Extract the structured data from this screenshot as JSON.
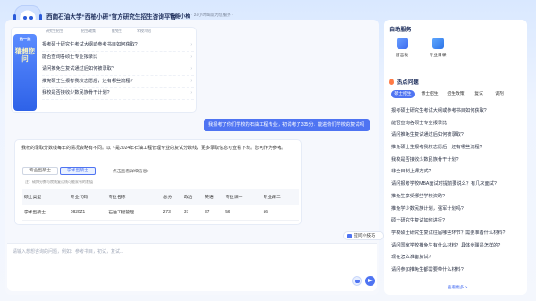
{
  "header": {
    "title": "西南石油大学“西柚小研”官方研究生招生咨询平台",
    "tag": "智能小柚",
    "subtitle": "· 24小时竭诚为您服务 ·"
  },
  "welcome": {
    "tabs": [
      "研究生招生",
      "招生政策",
      "推免生",
      "学校介绍"
    ],
    "banner_label": "热一热",
    "banner_vertical": "猜想您问",
    "questions": [
      "报考硕士研究生考试大纲或参考书目如何获取?",
      "能否查询各硕士专业报录比",
      "请问推免生复试通过后如何被录取?",
      "推免硕士生报考我校志愿后，还有哪些流程?",
      "我校是否接收少数民族骨干计划?"
    ]
  },
  "user_message": "我报考了你们学校的石油工程专业，初试考了335分，能进你们学校的复试吗",
  "answer": {
    "paragraph": "我校的录取分数线每年的情况会略有不同。以下是2024年石油工程管理专业的复试分数线，更多录取信息可查看下表。您可作为参考。",
    "seg_options": [
      "专业型硕士",
      "学术型硕士"
    ],
    "seg_active": 1,
    "hint": "点击查看详细信息>",
    "note": "注：硕博分数与院线复试线可能家有的差值",
    "table": {
      "headers": [
        "硕士类型",
        "专业代码",
        "专业名称",
        "总分",
        "政治",
        "英语",
        "专业课一",
        "专业课二"
      ],
      "rows": [
        [
          "学术型硕士",
          "0820Z1",
          "石油工程管理",
          "273",
          "37",
          "37",
          "56",
          "56"
        ]
      ]
    }
  },
  "tips_chip": "提问小技巧",
  "input": {
    "placeholder": "请输入想想咨询的问题，例如：参考书目，初试，复试..."
  },
  "right_panel": {
    "service_title": "自助服务",
    "services": [
      {
        "label": "留言板",
        "icon": "message-board-icon"
      },
      {
        "label": "专业目录",
        "icon": "catalog-icon"
      }
    ],
    "hot_title": "热点问题",
    "chips": [
      "硕士招生",
      "博士招生",
      "招生政策",
      "复试",
      "调剂"
    ],
    "chip_active": 0,
    "hot_questions": [
      "报考硕士研究生考试大纲或参考书目如何获取?",
      "能否查询各硕士专业报录比",
      "请问推免生复试通过后如何被录取?",
      "推免硕士生报考我校志愿后，还有哪些流程?",
      "我校是否接收少数民族骨干计划?",
      "非全日制上课方式?",
      "请问报考学校MBA面试时提前要说么？有几次面试?",
      "推免生享受哪些学校资助?",
      "推免学少数民族计划，强军计划吗?",
      "硕士研究生复试如何进行?",
      "学校硕士研究生复试往届哪些环节？需要准备什么材料?",
      "请问国家学校推免生有什么材料？具体步骤是怎样的?",
      "现在怎么准备复试?",
      "请问参加推免生都需要带什么材料?"
    ],
    "more": "查看更多 >"
  },
  "colors": {
    "accent": "#4f74f2",
    "title": "#1f2f5c",
    "background": "#eef4ff"
  }
}
